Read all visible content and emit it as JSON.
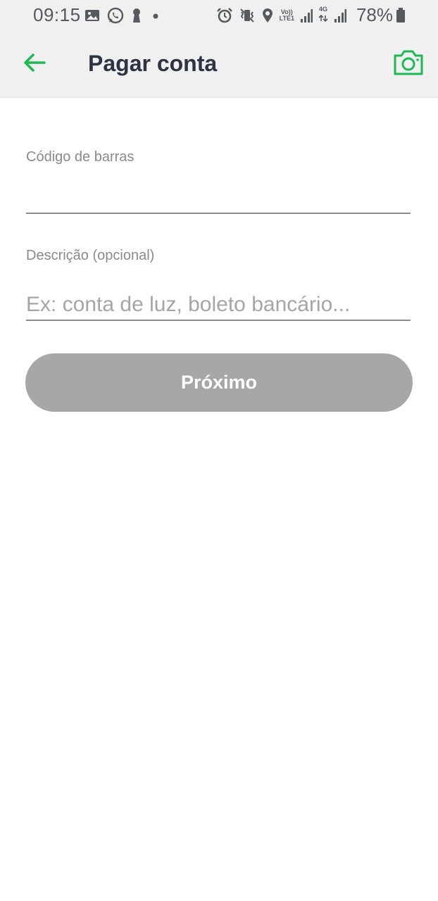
{
  "status_bar": {
    "time": "09:15",
    "battery_percent": "78%",
    "network_label_top": "Vo))",
    "network_label_bottom": "LTE1",
    "network_type": "4G",
    "left_icons": [
      "gallery-icon",
      "whatsapp-icon",
      "keyhole-icon",
      "dot-icon"
    ],
    "right_icons": [
      "alarm-icon",
      "vibrate-icon",
      "location-icon",
      "volte-icon",
      "signal-icon",
      "4g-icon",
      "signal-icon",
      "battery-icon"
    ]
  },
  "header": {
    "title": "Pagar conta",
    "back_icon": "arrow-left-icon",
    "camera_icon": "camera-icon",
    "accent_color": "#1db954"
  },
  "form": {
    "barcode_label": "Código de barras",
    "barcode_value": "",
    "description_label": "Descrição (opcional)",
    "description_placeholder": "Ex: conta de luz, boleto bancário...",
    "description_value": ""
  },
  "actions": {
    "next_label": "Próximo",
    "next_button_color": "#a7a7a7"
  }
}
